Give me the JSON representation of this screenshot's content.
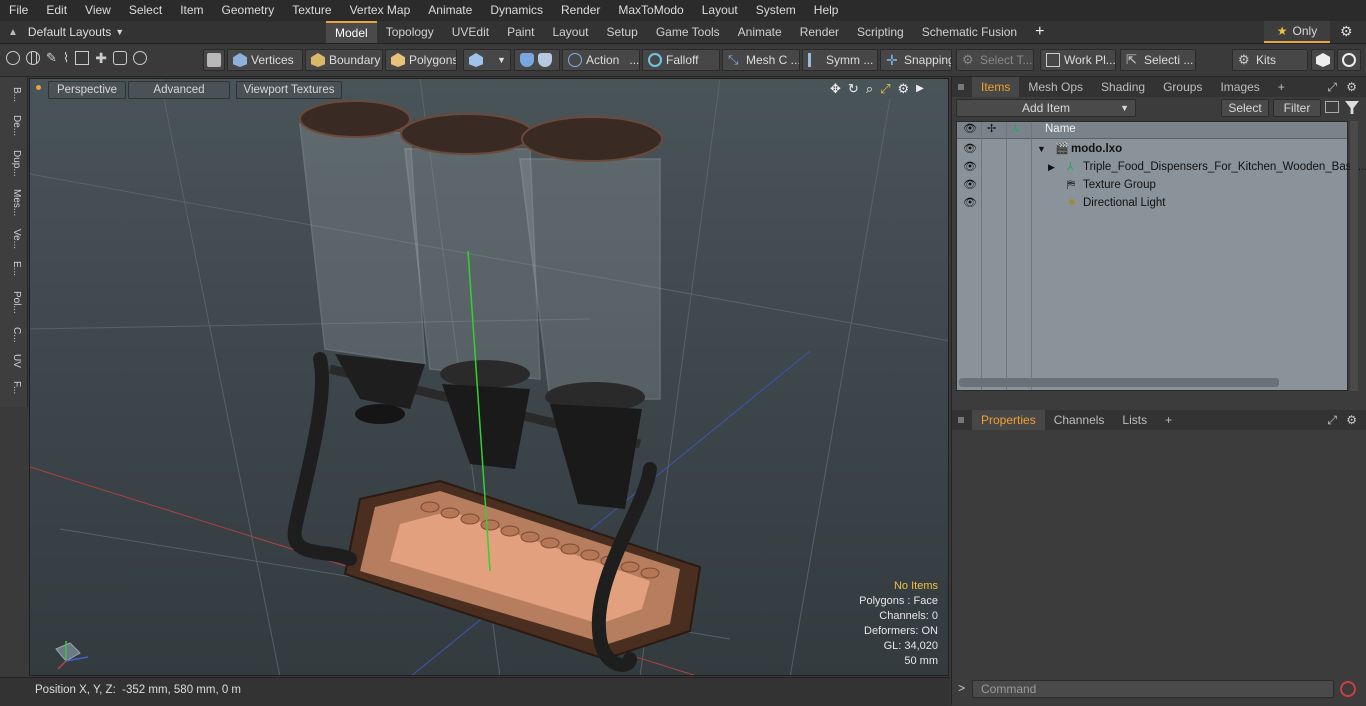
{
  "menu": [
    "File",
    "Edit",
    "View",
    "Select",
    "Item",
    "Geometry",
    "Texture",
    "Vertex Map",
    "Animate",
    "Dynamics",
    "Render",
    "MaxToModo",
    "Layout",
    "System",
    "Help"
  ],
  "layout": {
    "picker_label": "Default Layouts",
    "tabs": [
      "Model",
      "Topology",
      "UVEdit",
      "Paint",
      "Layout",
      "Setup",
      "Game Tools",
      "Animate",
      "Render",
      "Scripting",
      "Schematic Fusion"
    ],
    "active_tab": "Model",
    "only_label": "Only"
  },
  "toolbar": {
    "vertices": "Vertices",
    "boundary": "Boundary",
    "polygons": "Polygons",
    "action": "Action",
    "falloff": "Falloff",
    "mesh": "Mesh C ...",
    "symm": "Symm ...",
    "snapping": "Snapping",
    "select_t": "Select T...",
    "workpl": "Work Pl...",
    "selecti": "Selecti ...",
    "kits": "Kits"
  },
  "left_tabs": [
    "B...",
    "De...",
    "Dup...",
    "Mes...",
    "Ve...",
    "E...",
    "Pol...",
    "C...",
    "UV",
    "F..."
  ],
  "viewport": {
    "perspective": "Perspective",
    "advanced": "Advanced",
    "textures": "Viewport Textures",
    "info": {
      "items": "No Items",
      "polygons": "Polygons : Face",
      "channels": "Channels: 0",
      "deformers": "Deformers: ON",
      "gl": "GL: 34,020",
      "size": "50 mm"
    }
  },
  "status": {
    "position": "Position X, Y, Z:  -352 mm, 580 mm, 0 m"
  },
  "items_panel": {
    "tabs": [
      "Items",
      "Mesh Ops",
      "Shading",
      "Groups",
      "Images"
    ],
    "add_item": "Add Item",
    "select": "Select",
    "filter": "Filter",
    "name_header": "Name",
    "rows": [
      "modo.lxo",
      "Triple_Food_Dispensers_For_Kitchen_Wooden_Base...",
      "Texture Group",
      "Directional Light"
    ]
  },
  "props_panel": {
    "tabs": [
      "Properties",
      "Channels",
      "Lists"
    ]
  },
  "command": {
    "placeholder": "Command"
  },
  "colors": {
    "accent": "#e9a43a",
    "viewport_bg": "#3f484d"
  }
}
